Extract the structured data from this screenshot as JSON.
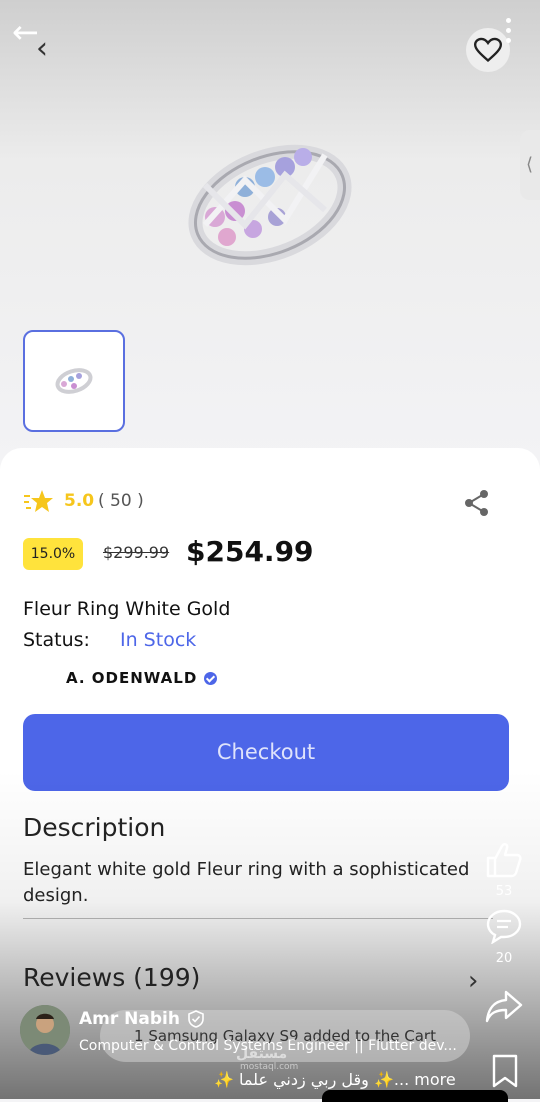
{
  "reel": {
    "author_name": "Amr Nabih",
    "author_bio": "Computer & Control Systems Engineer || Flutter dev...",
    "caption": "✨ وقل ربي زدني علما ✨... more",
    "likes": "53",
    "comments": "20",
    "watermark": "مستقل",
    "watermark_sub": "mostaql.com"
  },
  "product": {
    "rating": "5.0",
    "rating_count": "( 50 )",
    "discount": "15.0%",
    "old_price": "$299.99",
    "price": "$254.99",
    "title": "Fleur Ring White Gold",
    "status_label": "Status:",
    "status_value": "In Stock",
    "brand": "A. ODENWALD",
    "checkout_label": "Checkout",
    "description_heading": "Description",
    "description_text": "Elegant white gold Fleur ring with a sophisticated design.",
    "reviews_heading": "Reviews (199)"
  },
  "toast": "1 Samsung Galaxy S9 added to the Cart",
  "colors": {
    "accent": "#4d66e8",
    "star": "#f6c61c",
    "discount_badge": "#ffe33c"
  },
  "icons": [
    "back-arrow-icon",
    "chevron-left-icon",
    "heart-icon",
    "more-vert-icon",
    "star-icon",
    "share-icon",
    "thumbs-up-icon",
    "comment-icon",
    "reel-share-icon",
    "bookmark-icon",
    "verified-icon",
    "chevron-right-icon"
  ]
}
